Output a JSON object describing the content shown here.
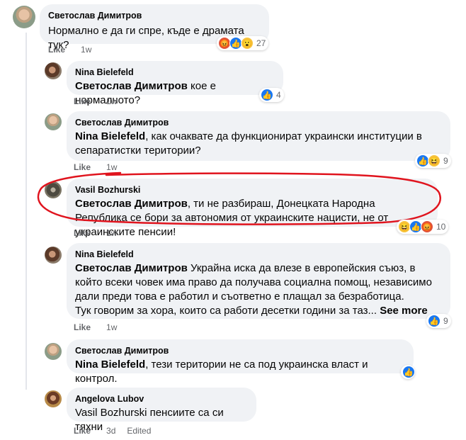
{
  "actions": {
    "like": "Like",
    "edited": "Edited"
  },
  "comments": [
    {
      "author": "Светослав Димитров",
      "mention": "",
      "text": "Нормално е да ги спре, къде е драмата тук?",
      "time": "1w",
      "reactions": [
        "angry-icon",
        "like-icon",
        "wow-icon"
      ],
      "reaction_count": "27"
    },
    {
      "author": "Nina Bielefeld",
      "mention": "Светослав Димитров",
      "text": " кое е нормалното?",
      "time": "1w",
      "reactions": [
        "like-icon"
      ],
      "reaction_count": "4"
    },
    {
      "author": "Светослав Димитров",
      "mention": "Nina Bielefeld",
      "text": ", как очаквате да функционират украински институции в сепаратистки територии?",
      "time": "1w",
      "reactions": [
        "like-icon",
        "haha-icon"
      ],
      "reaction_count": "9"
    },
    {
      "author": "Vasil Bozhurski",
      "mention": "Светослав Димитров",
      "text": ", ти не разбираш, Донецката Народна Република се бори за автономия от украинските нацисти, не от украинските пенсии!",
      "time": "1w",
      "reactions": [
        "haha-icon",
        "like-icon",
        "angry-icon"
      ],
      "reaction_count": "10"
    },
    {
      "author": "Nina Bielefeld",
      "mention": "Светослав Димитров",
      "text": " Украйна иска да влезе в европейския съюз, в който всеки човек има право да получава социална помощ, независимо дали преди това е работил и съответно е плащал за безработица.",
      "text2": "Тук говорим за хора, които са работи десетки години за таз...",
      "see_more": "See more",
      "time": "1w",
      "reactions": [
        "like-icon"
      ],
      "reaction_count": "9"
    },
    {
      "author": "Светослав Димитров",
      "mention": "Nina Bielefeld",
      "text": ", тези територии не са под украинска власт и контрол.",
      "time": "1w",
      "reactions": [
        "like-icon"
      ],
      "reaction_count": ""
    },
    {
      "author": "Angelova Lubov",
      "mention": "",
      "text": "Vasil Bozhurski пенсиите са си тяхни",
      "time": "3d",
      "reactions": [],
      "reaction_count": ""
    }
  ],
  "highlight_color": "#e0141e"
}
